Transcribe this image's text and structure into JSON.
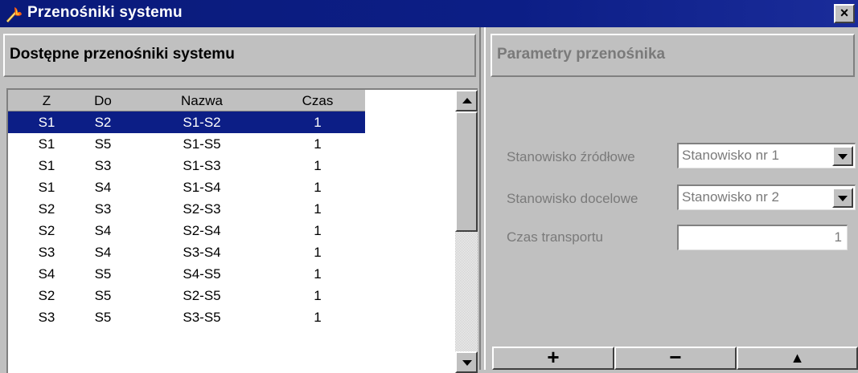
{
  "window": {
    "title": "Przenośniki systemu",
    "close_glyph": "×",
    "icon": "flame-wand-icon"
  },
  "left_panel": {
    "header": "Dostępne przenośniki systemu",
    "columns": [
      "Z",
      "Do",
      "Nazwa",
      "Czas"
    ],
    "rows": [
      {
        "z": "S1",
        "do": "S2",
        "nazwa": "S1-S2",
        "czas": "1",
        "selected": true
      },
      {
        "z": "S1",
        "do": "S5",
        "nazwa": "S1-S5",
        "czas": "1"
      },
      {
        "z": "S1",
        "do": "S3",
        "nazwa": "S1-S3",
        "czas": "1"
      },
      {
        "z": "S1",
        "do": "S4",
        "nazwa": "S1-S4",
        "czas": "1"
      },
      {
        "z": "S2",
        "do": "S3",
        "nazwa": "S2-S3",
        "czas": "1"
      },
      {
        "z": "S2",
        "do": "S4",
        "nazwa": "S2-S4",
        "czas": "1"
      },
      {
        "z": "S3",
        "do": "S4",
        "nazwa": "S3-S4",
        "czas": "1"
      },
      {
        "z": "S4",
        "do": "S5",
        "nazwa": "S4-S5",
        "czas": "1"
      },
      {
        "z": "S2",
        "do": "S5",
        "nazwa": "S2-S5",
        "czas": "1"
      },
      {
        "z": "S3",
        "do": "S5",
        "nazwa": "S3-S5",
        "czas": "1"
      }
    ]
  },
  "right_panel": {
    "header": "Parametry przenośnika",
    "source_label": "Stanowisko źródłowe",
    "source_value": "Stanowisko nr 1",
    "target_label": "Stanowisko docelowe",
    "target_value": "Stanowisko nr 2",
    "time_label": "Czas transportu",
    "time_value": "1",
    "buttons": {
      "add": "+",
      "remove": "−",
      "up": "▲"
    }
  },
  "colors": {
    "titlebar": "#0c1e86",
    "selection": "#0c1e86",
    "face": "#c0c0c0",
    "disabled_text": "#7a7a7a"
  }
}
